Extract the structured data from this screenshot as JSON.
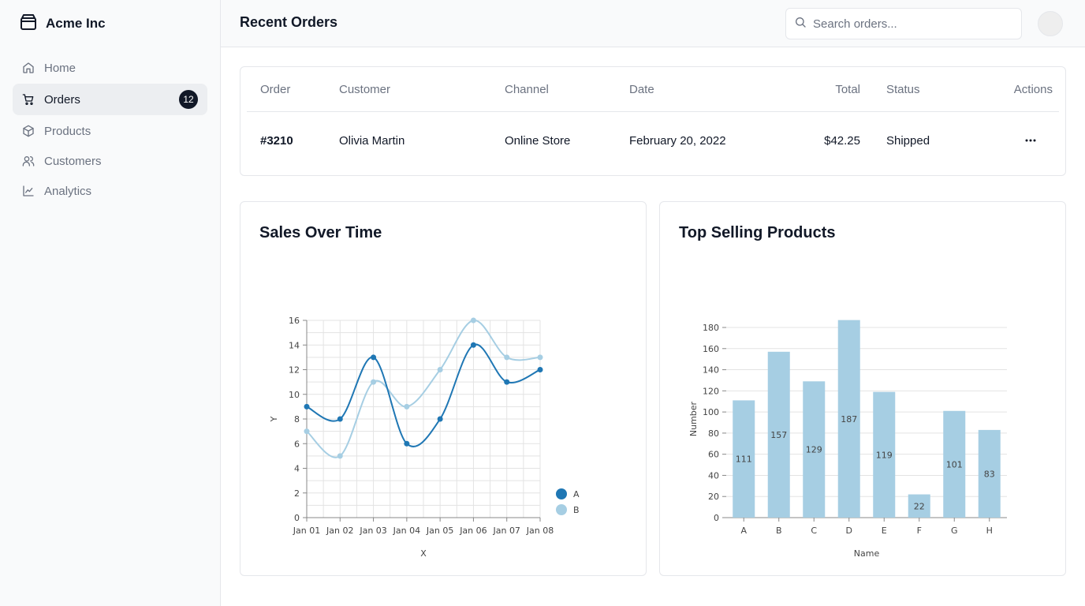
{
  "brand": {
    "name": "Acme Inc",
    "icon": "package-icon"
  },
  "sidebar": {
    "items": [
      {
        "label": "Home",
        "icon": "home-icon"
      },
      {
        "label": "Orders",
        "icon": "cart-icon",
        "badge": "12",
        "active": true
      },
      {
        "label": "Products",
        "icon": "box-icon"
      },
      {
        "label": "Customers",
        "icon": "users-icon"
      },
      {
        "label": "Analytics",
        "icon": "line-chart-icon"
      }
    ]
  },
  "header": {
    "title": "Recent Orders",
    "search_placeholder": "Search orders..."
  },
  "orders": {
    "columns": [
      "Order",
      "Customer",
      "Channel",
      "Date",
      "Total",
      "Status",
      "Actions"
    ],
    "rows": [
      {
        "order": "#3210",
        "customer": "Olivia Martin",
        "channel": "Online Store",
        "date": "February 20, 2022",
        "total": "$42.25",
        "status": "Shipped"
      }
    ]
  },
  "charts": {
    "sales_title": "Sales Over Time",
    "products_title": "Top Selling Products"
  },
  "chart_data": [
    {
      "type": "line",
      "title": "Sales Over Time",
      "xlabel": "X",
      "ylabel": "Y",
      "x": [
        "Jan 01",
        "Jan 02",
        "Jan 03",
        "Jan 04",
        "Jan 05",
        "Jan 06",
        "Jan 07",
        "Jan 08"
      ],
      "ylim": [
        0,
        16
      ],
      "yticks": [
        0,
        2,
        4,
        6,
        8,
        10,
        12,
        14,
        16
      ],
      "grid": true,
      "legend": "right",
      "series": [
        {
          "name": "A",
          "color": "#1f77b4",
          "values": [
            9,
            8,
            13,
            6,
            8,
            14,
            11,
            12
          ]
        },
        {
          "name": "B",
          "color": "#a6cee3",
          "values": [
            7,
            5,
            11,
            9,
            12,
            16,
            13,
            13
          ]
        }
      ]
    },
    {
      "type": "bar",
      "title": "Top Selling Products",
      "xlabel": "Name",
      "ylabel": "Number",
      "categories": [
        "A",
        "B",
        "C",
        "D",
        "E",
        "F",
        "G",
        "H"
      ],
      "values": [
        111,
        157,
        129,
        187,
        119,
        22,
        101,
        83
      ],
      "ylim": [
        0,
        180
      ],
      "yticks": [
        0,
        20,
        40,
        60,
        80,
        100,
        120,
        140,
        160,
        180
      ],
      "grid": true,
      "color": "#a6cee3"
    }
  ]
}
